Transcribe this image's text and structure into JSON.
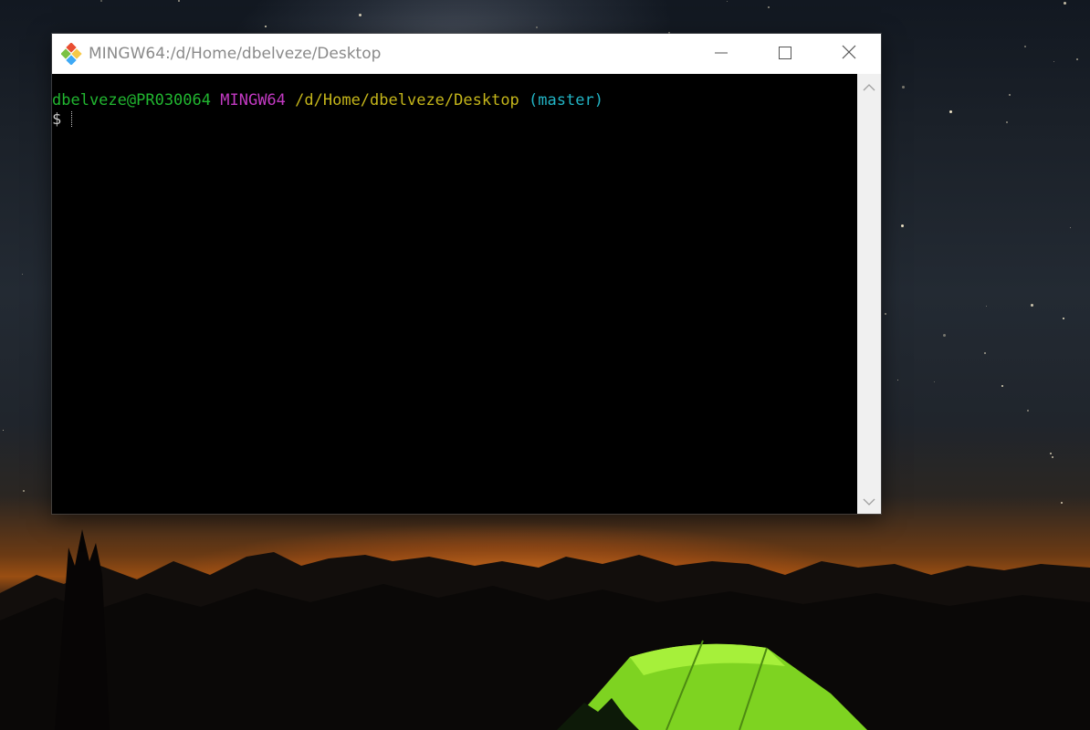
{
  "window": {
    "title": "MINGW64:/d/Home/dbelveze/Desktop",
    "icon": "git-bash-icon",
    "controls": {
      "minimize": "minimize-icon",
      "maximize": "maximize-icon",
      "close": "close-icon"
    }
  },
  "terminal": {
    "prompt_user_host": "dbelveze@PR030064",
    "prompt_system": "MINGW64",
    "prompt_path": "/d/Home/dbelveze/Desktop",
    "prompt_branch": "(master)",
    "prompt_symbol": "$",
    "colors": {
      "background": "#000000",
      "user_host": "#21b630",
      "system": "#c33ac3",
      "path": "#c4b51a",
      "branch": "#22b4c5",
      "text": "#c8c8c8"
    }
  },
  "scrollbar": {
    "up_icon": "chevron-up-icon",
    "down_icon": "chevron-down-icon"
  }
}
